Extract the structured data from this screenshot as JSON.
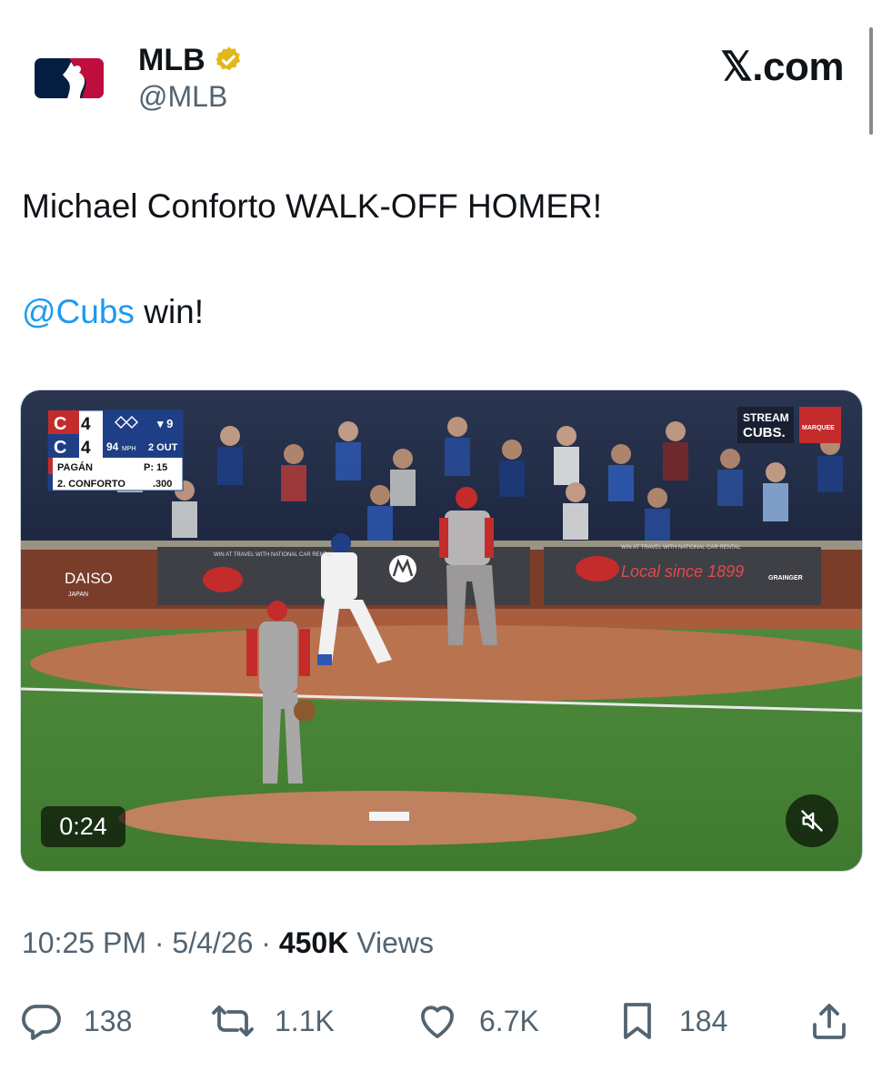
{
  "account": {
    "display_name": "MLB",
    "handle": "@MLB",
    "verified": true,
    "badge_color": "#e2b719"
  },
  "brand": "𝕏.com",
  "tweet": {
    "line1": "Michael Conforto WALK-OFF HOMER!",
    "mention": "@Cubs",
    "line2_rest": " win!"
  },
  "video": {
    "duration": "0:24",
    "scorebug": {
      "away_score": "4",
      "home_score": "4",
      "inning": "▾ 9",
      "pitch_speed": "94",
      "pitch_unit": "MPH",
      "outs": "2 OUT",
      "pitcher": "PAGÁN",
      "pitch_count": "P: 15",
      "batter": "2. CONFORTO",
      "batter_avg": ".300"
    },
    "broadcast_bug": {
      "line1": "STREAM",
      "line2": "CUBS.",
      "sponsor": "MARQUEE"
    },
    "signs": {
      "daiso": "DAISO",
      "daiso_sub": "JAPAN",
      "jewel": "Jewel Osco",
      "local_since": "Local since 1899",
      "banner_top": "WIN AT TRAVEL WITH NATIONAL CAR RENTAL",
      "grainger": "GRAINGER"
    }
  },
  "meta": {
    "time": "10:25 PM",
    "sep": " · ",
    "date": "5/4/26",
    "views_count": "450K",
    "views_label": " Views"
  },
  "actions": {
    "replies": "138",
    "reposts": "1.1K",
    "likes": "6.7K",
    "bookmarks": "184"
  },
  "colors": {
    "link": "#1d9bf0",
    "secondary_text": "#536471",
    "primary_text": "#0f1419",
    "mlb_blue": "#041e42",
    "mlb_red": "#bf0d3e"
  }
}
